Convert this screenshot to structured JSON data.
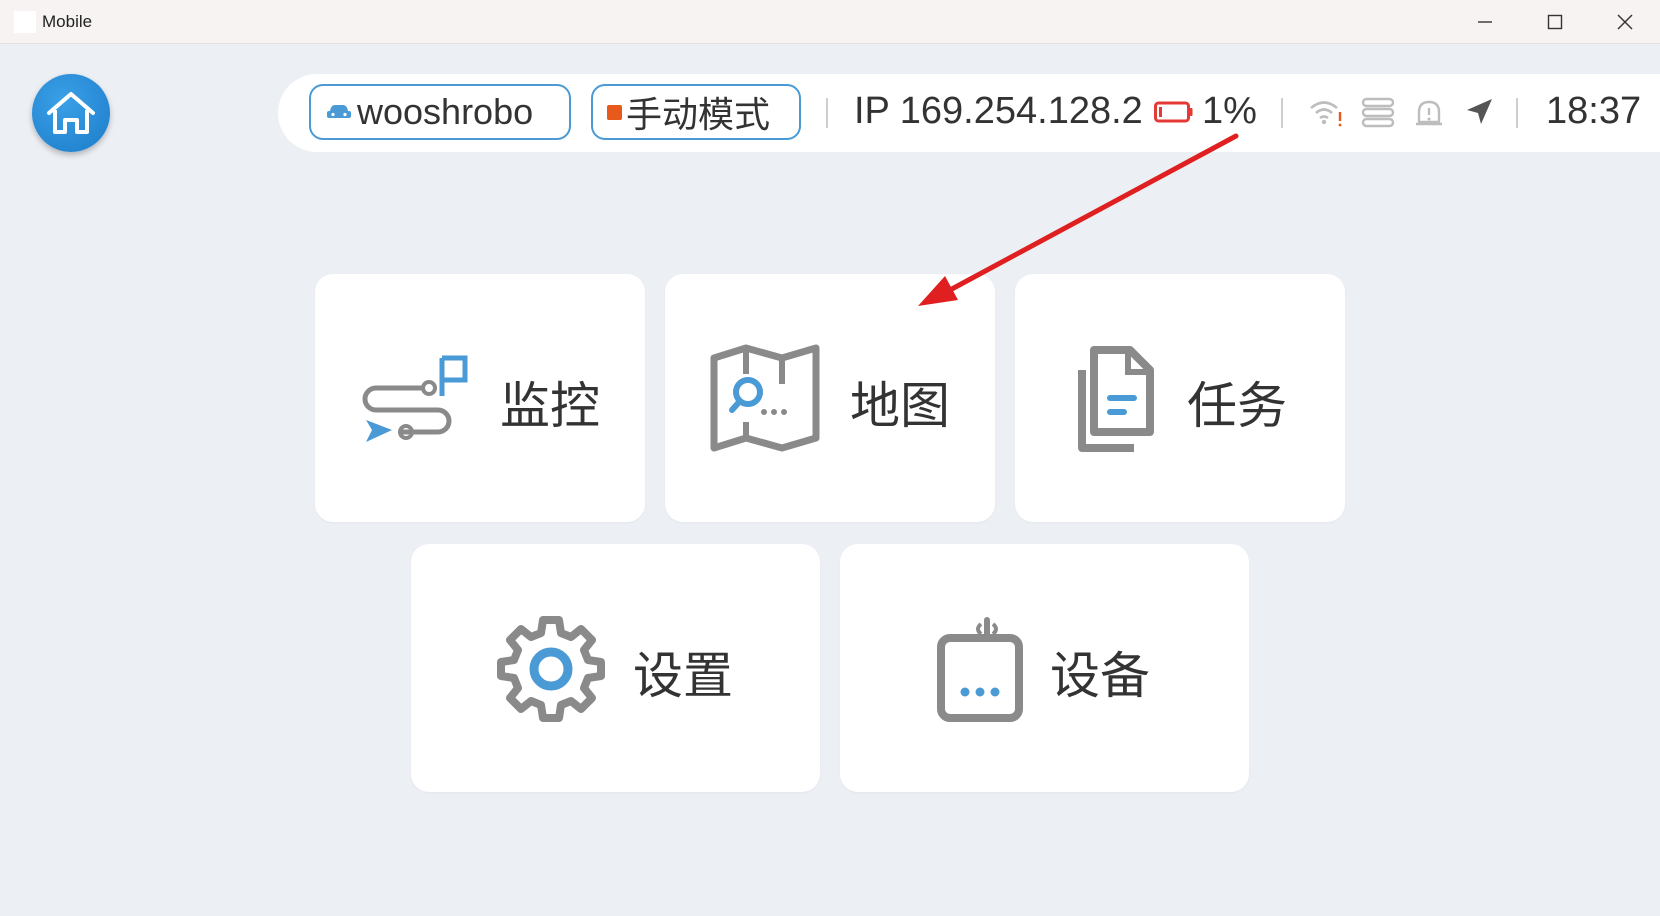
{
  "window": {
    "title": "Mobile",
    "controls": [
      "minimize",
      "maximize",
      "close"
    ]
  },
  "header": {
    "home_icon": "home-icon",
    "robot_name": "wooshrobo",
    "robot_icon": "robot-car-icon",
    "mode": "手动模式",
    "mode_color": "#e85a1c",
    "ip": "IP 169.254.128.2",
    "battery": "1%",
    "battery_color": "#e53935",
    "status_icons": [
      "wifi-warning-icon",
      "server-icon",
      "alert-icon",
      "navigation-icon"
    ],
    "time": "18:37"
  },
  "menu": {
    "tiles": [
      {
        "label": "监控",
        "icon": "monitor-route-icon"
      },
      {
        "label": "地图",
        "icon": "map-search-icon"
      },
      {
        "label": "任务",
        "icon": "task-document-icon"
      },
      {
        "label": "设置",
        "icon": "gear-icon"
      },
      {
        "label": "设备",
        "icon": "device-icon"
      }
    ]
  },
  "colors": {
    "accent": "#4a9ad6",
    "icon_gray": "#8a8a8a",
    "background": "#eceff4",
    "annotation_arrow": "#e02020"
  }
}
